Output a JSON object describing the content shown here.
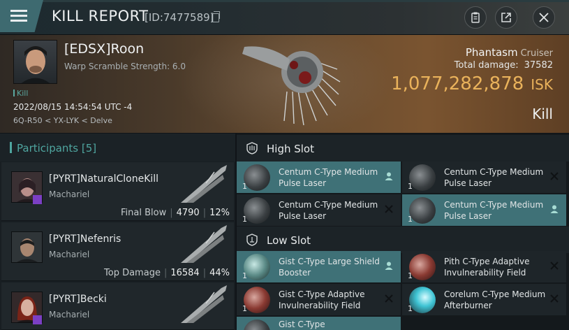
{
  "header": {
    "title": "KILL REPORT",
    "report_id": "[ID:7477589]"
  },
  "victim": {
    "name": "[EDSX]Roon",
    "warp_scramble": "Warp Scramble Strength: 6.0",
    "tag": "Kill",
    "datetime": "2022/08/15 14:54:54 UTC -4",
    "location": "6Q-R50 < YX-LYK < Delve",
    "ship_name": "Phantasm",
    "ship_class": "Cruiser",
    "total_damage_label": "Total damage:",
    "total_damage": "37582",
    "isk_value": "1,077,282,878",
    "isk_unit": "ISK",
    "result": "Kill"
  },
  "participants": {
    "label": "Participants",
    "count": "[5]",
    "rows": [
      {
        "name": "[PYRT]NaturalCloneKill",
        "ship": "Machariel",
        "stat_label": "Final Blow",
        "damage": "4790",
        "percent": "12%"
      },
      {
        "name": "[PYRT]Nefenris",
        "ship": "Machariel",
        "stat_label": "Top Damage",
        "damage": "16584",
        "percent": "44%"
      },
      {
        "name": "[PYRT]Becki",
        "ship": "Machariel",
        "stat_label": "",
        "damage": "",
        "percent": ""
      }
    ]
  },
  "fitting": {
    "high_slot_label": "High Slot",
    "low_slot_label": "Low Slot",
    "high_modules": [
      {
        "qty": "1",
        "name": "Centum C-Type Medium Pulse Laser",
        "highlighted": true,
        "action": "person-icon"
      },
      {
        "qty": "1",
        "name": "Centum C-Type Medium Pulse Laser",
        "highlighted": false,
        "action": "close-icon"
      },
      {
        "qty": "1",
        "name": "Centum C-Type Medium Pulse Laser",
        "highlighted": false,
        "action": "close-icon"
      },
      {
        "qty": "1",
        "name": "Centum C-Type Medium Pulse Laser",
        "highlighted": true,
        "action": "person-icon"
      }
    ],
    "low_modules": [
      {
        "qty": "1",
        "name": "Gist C-Type Large Shield Booster",
        "highlighted": true,
        "action": "person-icon"
      },
      {
        "qty": "1",
        "name": "Pith C-Type Adaptive Invulnerability Field",
        "highlighted": false,
        "action": "close-icon"
      },
      {
        "qty": "1",
        "name": "Gist C-Type Adaptive Invulnerability Field",
        "highlighted": false,
        "action": "close-icon"
      },
      {
        "qty": "1",
        "name": "Corelum C-Type Medium Afterburner",
        "highlighted": false,
        "action": "close-icon"
      },
      {
        "qty": "",
        "name": "Gist C-Type",
        "highlighted": true,
        "action": ""
      }
    ]
  },
  "colors": {
    "accent_teal": "#4fa6a0",
    "highlight_row": "#3f7177",
    "isk_gold": "#e9b25b",
    "badge_purple": "#7b3fc4"
  }
}
